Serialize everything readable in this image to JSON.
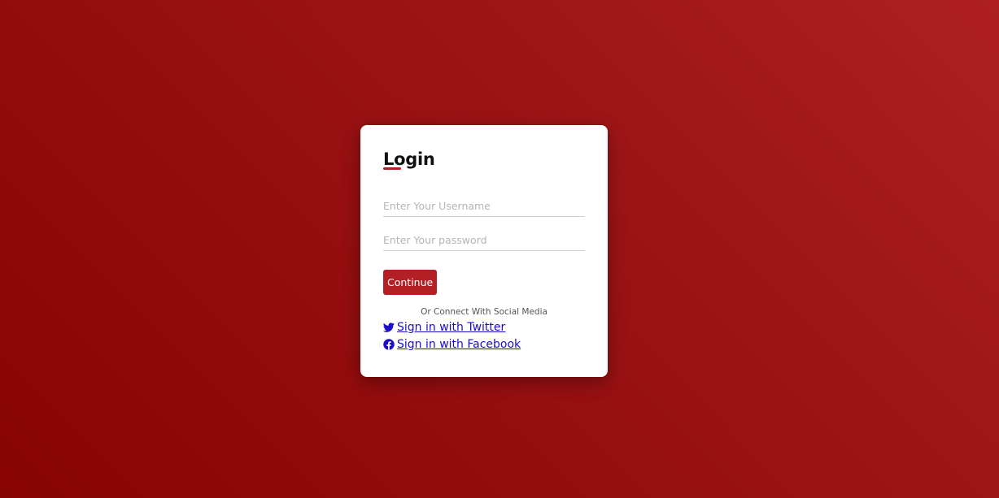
{
  "login": {
    "title": "Login",
    "username_placeholder": "Enter Your Username",
    "password_placeholder": "Enter Your password",
    "continue_label": "Continue",
    "social_caption": "Or Connect With Social Media",
    "twitter_label": " Sign in with Twitter",
    "facebook_label": " Sign in with Facebook",
    "twitter_icon": "twitter-icon",
    "facebook_icon": "facebook-icon"
  },
  "colors": {
    "accent": "#b21f24",
    "background_top_right": "#ad1f22",
    "background_bottom_left": "#870404",
    "link": "#1a0dcc"
  }
}
